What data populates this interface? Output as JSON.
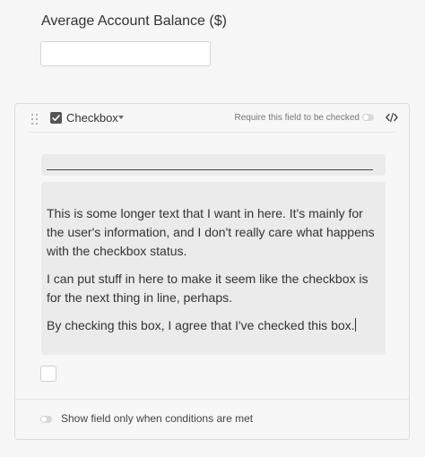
{
  "prev_field": {
    "label": "Average Account Balance ($)",
    "value": "",
    "placeholder": ""
  },
  "field": {
    "type_label": "Checkbox",
    "type_icon": "checkbox-checked-icon",
    "require_label": "Require this field to be checked",
    "require_checked": false,
    "description": {
      "paragraphs": [
        "This is some longer text that I want in here. It's mainly for the user's information, and I don't really care what happens with the checkbox status.",
        "I can put stuff in here to make it seem like the checkbox is for the next thing in line, perhaps.",
        "By checking this box, I agree that I've checked this box."
      ]
    },
    "answer_checked": false,
    "conditions_label": "Show field only when conditions are met",
    "conditions_enabled": false
  },
  "colors": {
    "background": "#f6f6f6",
    "card_background": "#f7f7f7",
    "block_background": "#ebebeb",
    "text": "#333333"
  }
}
